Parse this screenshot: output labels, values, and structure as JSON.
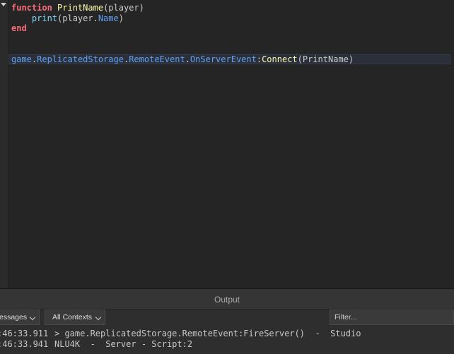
{
  "editor": {
    "lines": [
      [
        {
          "t": "kw",
          "v": "function"
        },
        {
          "t": "def",
          "v": " "
        },
        {
          "t": "fn",
          "v": "PrintName"
        },
        {
          "t": "def",
          "v": "(player)"
        }
      ],
      [
        {
          "t": "def",
          "v": "    "
        },
        {
          "t": "bi",
          "v": "print"
        },
        {
          "t": "def",
          "v": "(player."
        },
        {
          "t": "prop",
          "v": "Name"
        },
        {
          "t": "def",
          "v": ")"
        }
      ],
      [
        {
          "t": "kw",
          "v": "end"
        }
      ],
      [],
      [],
      [
        {
          "t": "prop",
          "v": "game"
        },
        {
          "t": "def",
          "v": "."
        },
        {
          "t": "prop",
          "v": "ReplicatedStorage"
        },
        {
          "t": "def",
          "v": "."
        },
        {
          "t": "prop",
          "v": "RemoteEvent"
        },
        {
          "t": "def",
          "v": "."
        },
        {
          "t": "prop",
          "v": "OnServerEvent"
        },
        {
          "t": "def",
          "v": ":"
        },
        {
          "t": "fn",
          "v": "Connect"
        },
        {
          "t": "def",
          "v": "(PrintName)"
        }
      ]
    ],
    "current_line": 5
  },
  "output": {
    "title": "Output",
    "messages_filter": "essages",
    "contexts_filter": "All Contexts",
    "filter_placeholder": "Filter...",
    "lines": [
      {
        "time": ":46:33.911",
        "text": "> game.ReplicatedStorage.RemoteEvent:FireServer()  -  Studio"
      },
      {
        "time": ":46:33.941",
        "text": "NLU4K  -  Server - Script:2"
      }
    ]
  },
  "colors": {
    "keyword": "#f86d7c",
    "function": "#fdfbac",
    "property": "#61a1f1",
    "builtin": "#84d6f7",
    "default": "#cccccc"
  }
}
